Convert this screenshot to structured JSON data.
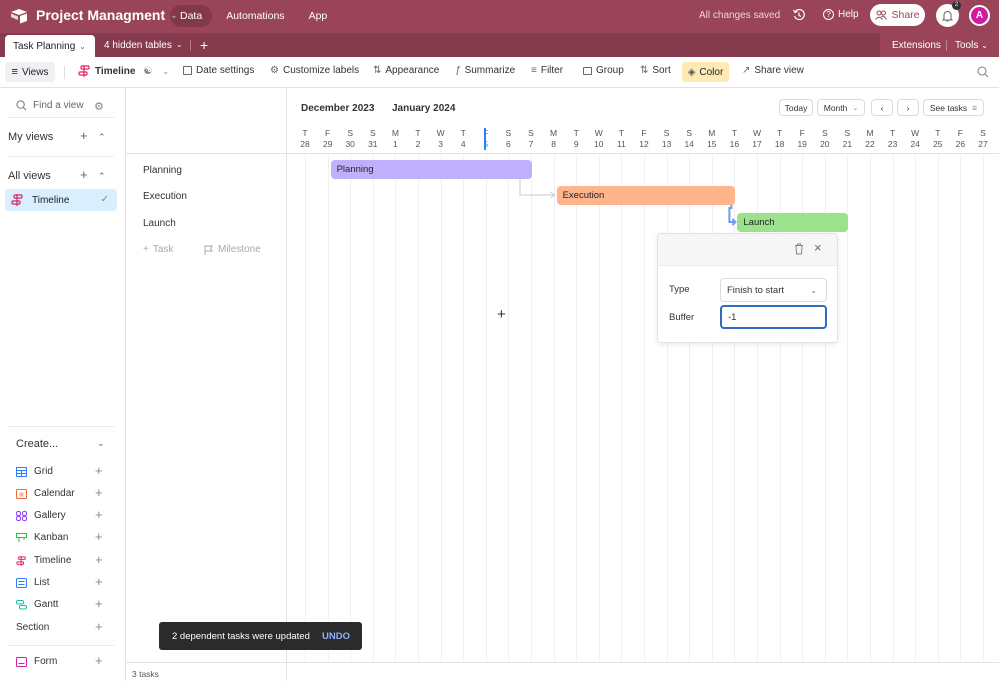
{
  "appbar": {
    "base_name": "Project Managment",
    "nav": [
      "Data",
      "Automations",
      "App"
    ],
    "active_nav": "Data",
    "save_status": "All changes saved",
    "help_label": "Help",
    "share_label": "Share",
    "notification_count": "2",
    "avatar_initial": "A",
    "brand_color": "#9a4459"
  },
  "tabbar": {
    "active_table": "Task Planning",
    "hidden_tables": "4 hidden tables",
    "extensions_label": "Extensions",
    "tools_label": "Tools"
  },
  "toolbar": {
    "views_label": "Views",
    "view_name": "Timeline",
    "items": [
      "Date settings",
      "Customize labels",
      "Appearance",
      "Summarize",
      "Filter",
      "Group",
      "Sort",
      "Color",
      "Share view"
    ]
  },
  "sidebar": {
    "find_placeholder": "Find a view",
    "my_views": "My views",
    "all_views": "All views",
    "views": [
      {
        "label": "Timeline",
        "selected": true
      }
    ],
    "create_title": "Create...",
    "create_items": [
      {
        "label": "Grid",
        "icon": "grid-icon",
        "color": "#2d7ff9"
      },
      {
        "label": "Calendar",
        "icon": "calendar-icon",
        "color": "#f26b3a"
      },
      {
        "label": "Gallery",
        "icon": "gallery-icon",
        "color": "#8b46ff"
      },
      {
        "label": "Kanban",
        "icon": "kanban-icon",
        "color": "#20c933"
      },
      {
        "label": "Timeline",
        "icon": "timeline-icon",
        "color": "#e0245e"
      },
      {
        "label": "List",
        "icon": "list-icon",
        "color": "#2d7ff9"
      },
      {
        "label": "Gantt",
        "icon": "gantt-icon",
        "color": "#18bfaa"
      }
    ],
    "section_label": "Section",
    "form_label": "Form"
  },
  "records": {
    "items": [
      "Planning",
      "Execution",
      "Launch"
    ],
    "add_task": "Task",
    "add_milestone": "Milestone",
    "count_label": "3 tasks"
  },
  "timeline": {
    "months": [
      "December 2023",
      "January 2024"
    ],
    "today_label": "Today",
    "scale_label": "Month",
    "see_tasks_label": "See tasks",
    "days": [
      {
        "d": "T",
        "n": "28"
      },
      {
        "d": "F",
        "n": "29"
      },
      {
        "d": "S",
        "n": "30"
      },
      {
        "d": "S",
        "n": "31"
      },
      {
        "d": "M",
        "n": "1"
      },
      {
        "d": "T",
        "n": "2"
      },
      {
        "d": "W",
        "n": "3"
      },
      {
        "d": "T",
        "n": "4"
      },
      {
        "d": "F",
        "n": "5"
      },
      {
        "d": "S",
        "n": "6"
      },
      {
        "d": "S",
        "n": "7"
      },
      {
        "d": "M",
        "n": "8"
      },
      {
        "d": "T",
        "n": "9"
      },
      {
        "d": "W",
        "n": "10"
      },
      {
        "d": "T",
        "n": "11"
      },
      {
        "d": "F",
        "n": "12"
      },
      {
        "d": "S",
        "n": "13"
      },
      {
        "d": "S",
        "n": "14"
      },
      {
        "d": "M",
        "n": "15"
      },
      {
        "d": "T",
        "n": "16"
      },
      {
        "d": "W",
        "n": "17"
      },
      {
        "d": "T",
        "n": "18"
      },
      {
        "d": "F",
        "n": "19"
      },
      {
        "d": "S",
        "n": "20"
      },
      {
        "d": "S",
        "n": "21"
      },
      {
        "d": "M",
        "n": "22"
      },
      {
        "d": "T",
        "n": "23"
      },
      {
        "d": "W",
        "n": "24"
      },
      {
        "d": "T",
        "n": "25"
      },
      {
        "d": "F",
        "n": "26"
      },
      {
        "d": "S",
        "n": "27"
      }
    ],
    "today_index": 8,
    "tasks": [
      {
        "label": "Planning",
        "start_index": 1,
        "end_index": 10,
        "color": "#c0b0fb"
      },
      {
        "label": "Execution",
        "start_index": 11,
        "end_index": 19,
        "color": "#ffb48c"
      },
      {
        "label": "Launch",
        "start_index": 19,
        "end_index": 24,
        "color": "#9ce28d"
      }
    ]
  },
  "popover": {
    "type_label": "Type",
    "type_value": "Finish to start",
    "buffer_label": "Buffer",
    "buffer_value": "-1"
  },
  "toast": {
    "message": "2 dependent tasks were updated",
    "action": "UNDO"
  }
}
